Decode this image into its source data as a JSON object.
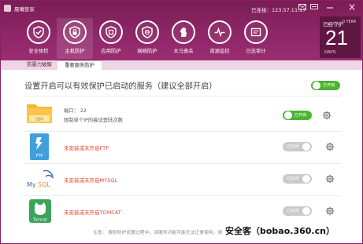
{
  "app": {
    "title": "晨曦管家",
    "ip_text": "已连接：123.57.11.17"
  },
  "window_controls": [
    "message-icon",
    "menu-icon",
    "minimize-icon",
    "close-icon"
  ],
  "nav": [
    {
      "label": "安全体检",
      "icon": "shield-check-icon"
    },
    {
      "label": "主机防护",
      "icon": "shield-lock-icon",
      "active": true
    },
    {
      "label": "应用防护",
      "icon": "app-shield-icon"
    },
    {
      "label": "网络防护",
      "icon": "network-shield-icon"
    },
    {
      "label": "木马查杀",
      "icon": "horse-icon"
    },
    {
      "label": "资源监控",
      "icon": "pulse-icon"
    },
    {
      "label": "日志审计",
      "icon": "log-icon"
    }
  ],
  "date": {
    "week": "已经守护",
    "year": "0 YEAR",
    "day": "21",
    "ym": "DAYS"
  },
  "subtabs": [
    "防暴力破解",
    "重要服务防护"
  ],
  "main": {
    "title": "设置开启可以有效保护已启动的服务（建议全部开启）",
    "master_toggle": "已开启"
  },
  "services": [
    {
      "name": "SSH",
      "icon": "ssh-folder-icon",
      "line1": "端口：  22",
      "line2": "限制单个IP的尝试登陆次数",
      "toggle": "已开启",
      "on": true
    },
    {
      "name": "FTP",
      "icon": "ftp-icon",
      "line1": "未安装或未开启FTP",
      "toggle": "已关闭",
      "on": false
    },
    {
      "name": "MySQL",
      "icon": "mysql-icon",
      "line1": "未安装或未开启MYSQL",
      "toggle": "已关闭",
      "on": false
    },
    {
      "name": "Tomcat",
      "icon": "tomcat-icon",
      "line1": "未安装或未开启TOMCAT",
      "toggle": "已关闭",
      "on": false
    }
  ],
  "footer": {
    "note": "注意：  服务防护设置过程中，该服务功能可能无法正常使用，请",
    "watermark": "安全客（bobao.360.cn）"
  },
  "colors": {
    "header": "#8e2668",
    "accent_green": "#4cb534",
    "error_red": "#e8412b"
  }
}
